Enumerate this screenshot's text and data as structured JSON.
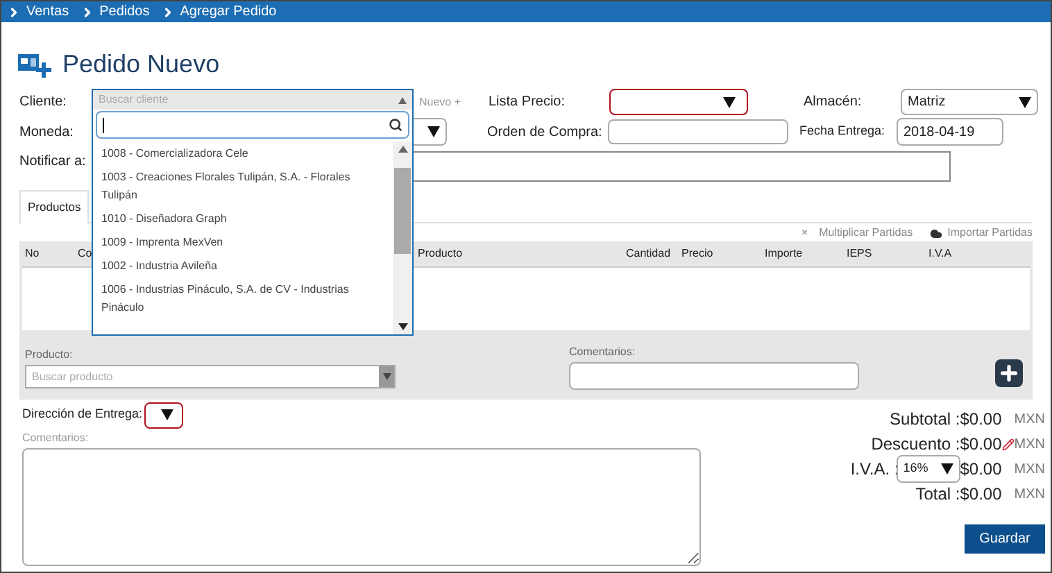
{
  "breadcrumb": [
    "Ventas",
    "Pedidos",
    "Agregar Pedido"
  ],
  "title": "Pedido Nuevo",
  "form": {
    "cliente": {
      "label": "Cliente:",
      "placeholder": "Buscar cliente"
    },
    "nuevo": "Nuevo +",
    "lista_precio": {
      "label": "Lista Precio:",
      "invalid": true
    },
    "almacen": {
      "label": "Almacén:",
      "value": "Matriz"
    },
    "moneda": {
      "label": "Moneda:"
    },
    "orden_compra": {
      "label": "Orden de Compra:"
    },
    "fecha_entrega": {
      "label": "Fecha Entrega:",
      "value": "2018-04-19"
    },
    "notificar": {
      "label": "Notificar a:"
    }
  },
  "client_dropdown": {
    "items": [
      {
        "text": "1008 - Comercializadora Cele"
      },
      {
        "text": "1003 - Creaciones Florales Tulipán, S.A. - Florales Tulipán"
      },
      {
        "text": "1010 - Diseñadora Graph"
      },
      {
        "text": "1009 - Imprenta MexVen"
      },
      {
        "text": "1002 - Industria Avileña"
      },
      {
        "text": "1006 - Industrias Pináculo, S.A. de CV - Industrias Pináculo"
      }
    ]
  },
  "tabs": [
    {
      "label": "Productos",
      "selected": true
    }
  ],
  "actions": [
    {
      "kind": "multiply",
      "icon": "×",
      "label": "Multiplicar Partidas"
    },
    {
      "kind": "import",
      "label": "Importar Partidas"
    }
  ],
  "table": {
    "columns": [
      "No",
      "Co",
      "Producto",
      "Cantidad",
      "Precio",
      "Importe",
      "IEPS",
      "I.V.A"
    ]
  },
  "product_entry": {
    "label": "Producto:",
    "placeholder": "Buscar producto",
    "comments_label": "Comentarios:"
  },
  "delivery": {
    "label": "Dirección de Entrega:",
    "invalid": true
  },
  "comments": {
    "label": "Comentarios:"
  },
  "totals": [
    {
      "kind": "plain",
      "label": "Subtotal :",
      "value": "$0.00",
      "currency": "MXN"
    },
    {
      "kind": "edit",
      "label": "Descuento :",
      "value": "$0.00",
      "currency": "MXN"
    },
    {
      "kind": "select",
      "label": "I.V.A. :",
      "option": "16%",
      "value": "$0.00",
      "currency": "MXN"
    },
    {
      "kind": "plain",
      "label": "Total :",
      "value": "$0.00",
      "currency": "MXN"
    }
  ],
  "save_button": "Guardar"
}
